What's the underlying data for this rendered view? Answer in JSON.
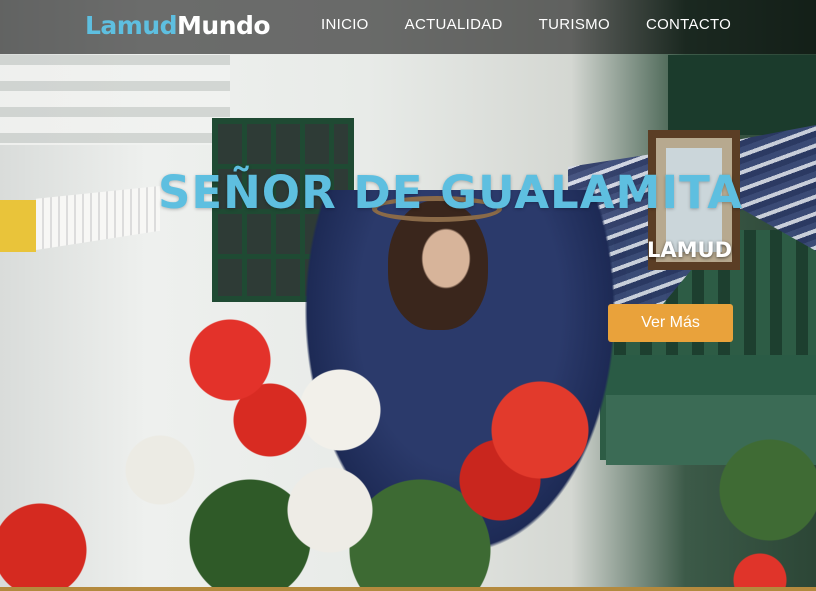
{
  "brand": {
    "part1": "Lamud",
    "part2": "Mundo"
  },
  "nav": {
    "items": [
      {
        "label": "INICIO"
      },
      {
        "label": "ACTUALIDAD"
      },
      {
        "label": "TURISMO"
      },
      {
        "label": "CONTACTO"
      }
    ]
  },
  "hero": {
    "title": "SEÑOR DE GUALAMITA",
    "subtitle": "LAMUD",
    "cta_label": "Ver Más"
  },
  "colors": {
    "accent": "#5ebfe0",
    "button": "#e9a23b",
    "navbar_bg": "rgba(0,0,0,0.55)"
  }
}
